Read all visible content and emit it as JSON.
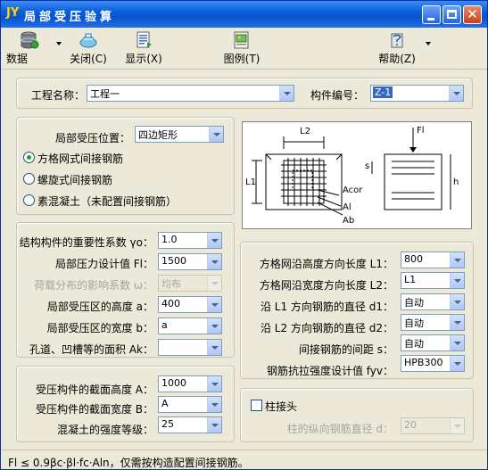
{
  "window": {
    "app_icon": "JY",
    "title": "局部受压验算",
    "colors": {
      "titlebar": "#0a5fd8",
      "face": "#ece9d8",
      "focus_highlight": "#316ac5"
    }
  },
  "toolbar": {
    "data": {
      "label": "数据",
      "icon": "database-icon"
    },
    "close": {
      "label": "关闭(C)",
      "icon": "close-file-icon"
    },
    "display": {
      "label": "显示(X)",
      "icon": "document-icon"
    },
    "figure": {
      "label": "图例(T)",
      "icon": "figure-icon"
    },
    "help": {
      "label": "帮助(Z)",
      "icon": "help-icon"
    }
  },
  "project": {
    "name_label": "工程名称：",
    "name_value": "工程一",
    "code_label": "构件编号：",
    "code_value": "Z-1"
  },
  "position": {
    "label": "局部受压位置：",
    "value": "四边矩形",
    "radios": [
      {
        "label": "方格网式间接钢筋",
        "checked": true
      },
      {
        "label": "螺旋式间接钢筋",
        "checked": false
      },
      {
        "label": "素混凝土（未配置间接钢筋）",
        "checked": false
      }
    ]
  },
  "diagram": {
    "labels": {
      "l2": "L2",
      "l1": "L1",
      "fl": "Fl",
      "acor": "Acor",
      "al": "Al",
      "ab": "Ab",
      "s": "s",
      "h": "h"
    }
  },
  "params": {
    "importance": {
      "label": "结构构件的重要性系数 γo：",
      "value": "1.0"
    },
    "pressure": {
      "label": "局部压力设计值 Fl：",
      "value": "1500"
    },
    "influence": {
      "label": "荷载分布的影响系数 ω：",
      "value": "均布"
    },
    "height_a": {
      "label": "局部受压区的高度 a：",
      "value": "400"
    },
    "width_b": {
      "label": "局部受压区的宽度 b：",
      "value": "a"
    },
    "hole_area": {
      "label": "孔道、凹槽等的面积 Ak：",
      "value": ""
    }
  },
  "section": {
    "height_A": {
      "label": "受压构件的截面高度 A：",
      "value": "1000"
    },
    "width_B": {
      "label": "受压构件的截面宽度 B：",
      "value": "A"
    },
    "concrete": {
      "label": "混凝土的强度等级：",
      "value": "25"
    }
  },
  "grid": {
    "l1": {
      "label": "方格网沿高度方向长度 L1：",
      "value": "800"
    },
    "l2": {
      "label": "方格网沿宽度方向长度 L2：",
      "value": "L1"
    },
    "d1": {
      "label": "沿 L1 方向钢筋的直径 d1：",
      "value": "自动"
    },
    "d2": {
      "label": "沿 L2 方向钢筋的直径 d2：",
      "value": "自动"
    },
    "s": {
      "label": "间接钢筋的间距 s：",
      "value": "自动"
    },
    "fyv": {
      "label": "钢筋抗拉强度设计值 fyv：",
      "value": "HPB300"
    }
  },
  "column_head": {
    "checkbox_label": "柱接头",
    "checked": false,
    "diameter_label": "柱的纵向钢筋直径 d：",
    "diameter_value": "20"
  },
  "status": {
    "text": "Fl ≤ 0.9βc·βl·fc·Aln，仅需按构造配置间接钢筋。"
  }
}
